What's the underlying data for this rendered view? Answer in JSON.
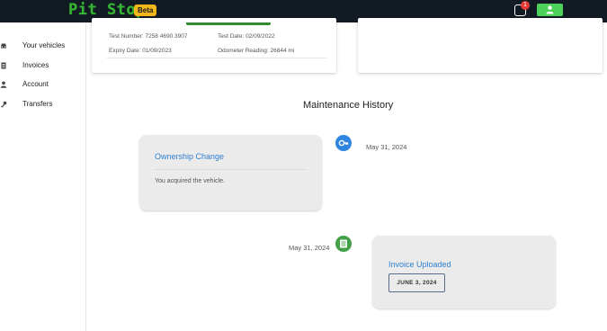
{
  "header": {
    "logo": "Pit Stop",
    "beta": "Beta",
    "notification_count": "1"
  },
  "sidebar": {
    "items": [
      {
        "label": "Your vehicles",
        "icon": "car-icon"
      },
      {
        "label": "Invoices",
        "icon": "receipt-icon"
      },
      {
        "label": "Account",
        "icon": "person-icon"
      },
      {
        "label": "Transfers",
        "icon": "key-icon"
      }
    ]
  },
  "mot_card": {
    "test_number": "Test Number: 7258 4690 3907",
    "test_date": "Test Date: 02/09/2022",
    "expiry_date": "Expiry Date: 01/09/2023",
    "odometer": "Odometer Reading: 26844 mi"
  },
  "history": {
    "title": "Maintenance History",
    "events": [
      {
        "title": "Ownership Change",
        "text": "You acquired the vehicle.",
        "date": "May 31, 2024",
        "icon": "key-icon",
        "color": "#2f86e0"
      },
      {
        "title": "Invoice Uploaded",
        "button": "JUNE 3, 2024",
        "date": "May 31, 2024",
        "icon": "document-icon",
        "color": "#43a047"
      }
    ]
  }
}
